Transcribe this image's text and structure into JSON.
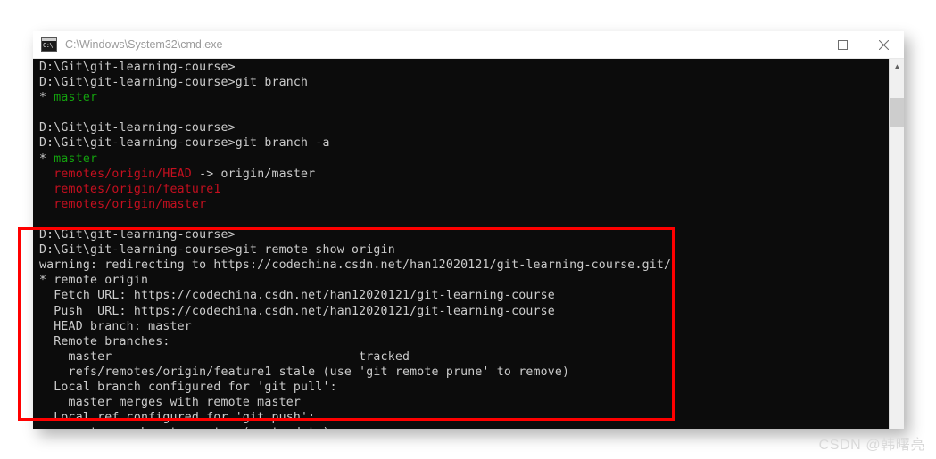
{
  "window": {
    "title": "C:\\Windows\\System32\\cmd.exe",
    "icon": "cmd-console-icon",
    "controls": {
      "minimize": "minimize",
      "maximize": "maximize",
      "close": "close"
    }
  },
  "colors": {
    "console_background": "#0c0c0c",
    "console_foreground": "#cccccc",
    "green": "#13a10e",
    "red": "#c50f1f",
    "annotation_box": "#ff0000",
    "titlebar_background": "#ffffff",
    "title_text": "#9b9b9b"
  },
  "scrollbar": {
    "up_arrow": "▲"
  },
  "annotation": {
    "box_label": "red-highlight-box"
  },
  "watermark": {
    "text": "CSDN @韩曙亮"
  },
  "terminal": {
    "prompt": "D:\\Git\\git-learning-course>",
    "lines": [
      {
        "segments": [
          {
            "text": "D:\\Git\\git-learning-course>",
            "color": "gray"
          }
        ]
      },
      {
        "segments": [
          {
            "text": "D:\\Git\\git-learning-course>git branch",
            "color": "gray"
          }
        ]
      },
      {
        "segments": [
          {
            "text": "* ",
            "color": "gray"
          },
          {
            "text": "master",
            "color": "green"
          }
        ]
      },
      {
        "segments": [
          {
            "text": "",
            "color": "gray"
          }
        ]
      },
      {
        "segments": [
          {
            "text": "D:\\Git\\git-learning-course>",
            "color": "gray"
          }
        ]
      },
      {
        "segments": [
          {
            "text": "D:\\Git\\git-learning-course>git branch -a",
            "color": "gray"
          }
        ]
      },
      {
        "segments": [
          {
            "text": "* ",
            "color": "gray"
          },
          {
            "text": "master",
            "color": "green"
          }
        ]
      },
      {
        "segments": [
          {
            "text": "  ",
            "color": "gray"
          },
          {
            "text": "remotes/origin/HEAD",
            "color": "red"
          },
          {
            "text": " -> origin/master",
            "color": "gray"
          }
        ]
      },
      {
        "segments": [
          {
            "text": "  ",
            "color": "gray"
          },
          {
            "text": "remotes/origin/feature1",
            "color": "red"
          }
        ]
      },
      {
        "segments": [
          {
            "text": "  ",
            "color": "gray"
          },
          {
            "text": "remotes/origin/master",
            "color": "red"
          }
        ]
      },
      {
        "segments": [
          {
            "text": "",
            "color": "gray"
          }
        ]
      },
      {
        "segments": [
          {
            "text": "D:\\Git\\git-learning-course>",
            "color": "gray"
          }
        ]
      },
      {
        "segments": [
          {
            "text": "D:\\Git\\git-learning-course>git remote show origin",
            "color": "gray"
          }
        ]
      },
      {
        "segments": [
          {
            "text": "warning: redirecting to https://codechina.csdn.net/han12020121/git-learning-course.git/",
            "color": "gray"
          }
        ]
      },
      {
        "segments": [
          {
            "text": "* remote origin",
            "color": "gray"
          }
        ]
      },
      {
        "segments": [
          {
            "text": "  Fetch URL: https://codechina.csdn.net/han12020121/git-learning-course",
            "color": "gray"
          }
        ]
      },
      {
        "segments": [
          {
            "text": "  Push  URL: https://codechina.csdn.net/han12020121/git-learning-course",
            "color": "gray"
          }
        ]
      },
      {
        "segments": [
          {
            "text": "  HEAD branch: master",
            "color": "gray"
          }
        ]
      },
      {
        "segments": [
          {
            "text": "  Remote branches:",
            "color": "gray"
          }
        ]
      },
      {
        "segments": [
          {
            "text": "    master                                  tracked",
            "color": "gray"
          }
        ]
      },
      {
        "segments": [
          {
            "text": "    refs/remotes/origin/feature1 stale (use 'git remote prune' to remove)",
            "color": "gray"
          }
        ]
      },
      {
        "segments": [
          {
            "text": "  Local branch configured for 'git pull':",
            "color": "gray"
          }
        ]
      },
      {
        "segments": [
          {
            "text": "    master merges with remote master",
            "color": "gray"
          }
        ]
      },
      {
        "segments": [
          {
            "text": "  Local ref configured for 'git push':",
            "color": "gray"
          }
        ]
      },
      {
        "segments": [
          {
            "text": "    master pushes to master (up to date)",
            "color": "gray"
          }
        ]
      }
    ]
  }
}
